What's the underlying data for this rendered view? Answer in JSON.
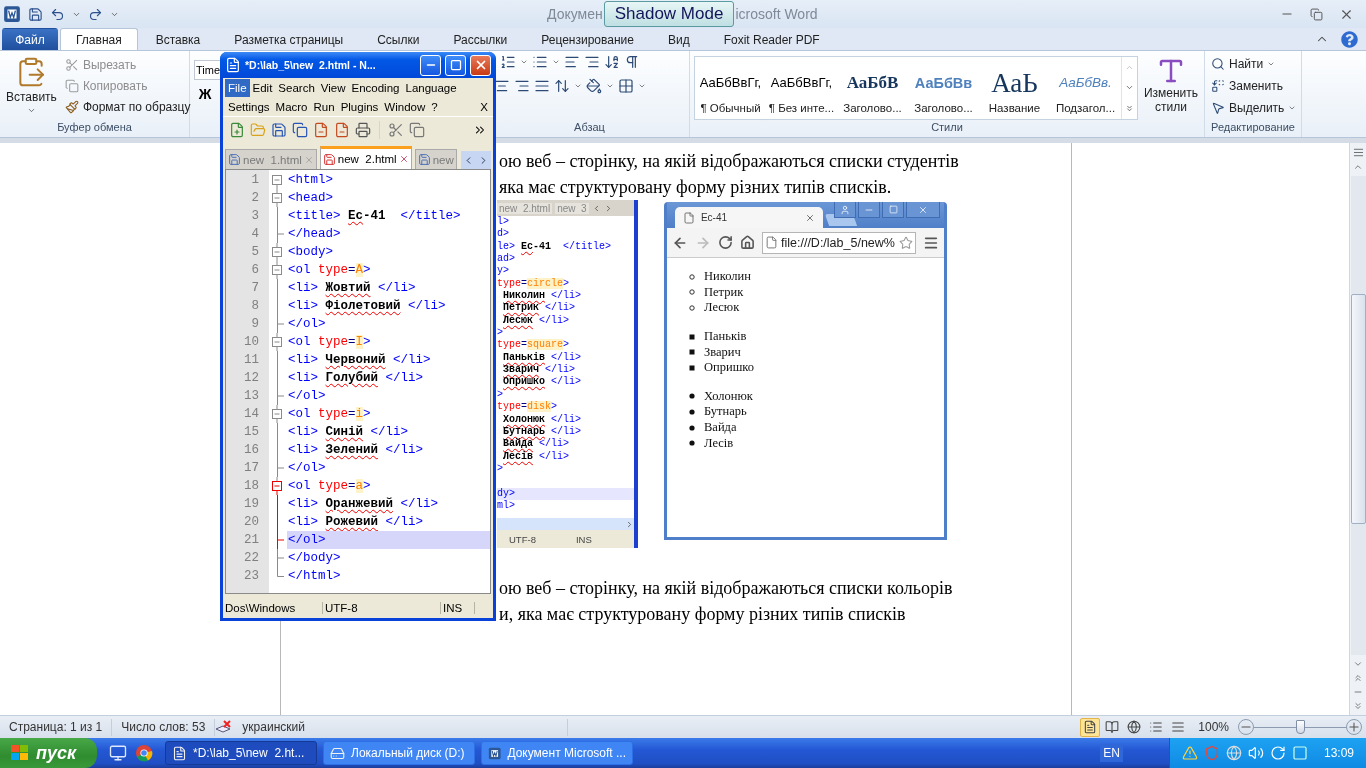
{
  "word": {
    "title": {
      "before": "Докумен",
      "overlay": "Shadow Mode",
      "after": "icrosoft Word"
    },
    "tabs": [
      {
        "label": "Файл",
        "kind": "file",
        "selected": false
      },
      {
        "label": "Главная",
        "kind": "tab",
        "selected": true
      },
      {
        "label": "Вставка",
        "kind": "tab",
        "selected": false
      },
      {
        "label": "Разметка страницы",
        "kind": "tab",
        "selected": false
      },
      {
        "label": "Ссылки",
        "kind": "tab",
        "selected": false
      },
      {
        "label": "Рассылки",
        "kind": "tab",
        "selected": false
      },
      {
        "label": "Рецензирование",
        "kind": "tab",
        "selected": false
      },
      {
        "label": "Вид",
        "kind": "tab",
        "selected": false
      },
      {
        "label": "Foxit Reader PDF",
        "kind": "tab",
        "selected": false
      }
    ],
    "clipboard": {
      "paste": "Вставить",
      "actions": [
        {
          "label": "Вырезать",
          "disabled": true
        },
        {
          "label": "Копировать",
          "disabled": true
        },
        {
          "label": "Формат по образцу",
          "disabled": false
        }
      ],
      "label": "Буфер обмена"
    },
    "font": {
      "font_name": "Time",
      "bold": "Ж"
    },
    "paragraph": {
      "label": "Абзац"
    },
    "styles": {
      "items": [
        {
          "sample": "АаБбВвГг,",
          "name": "¶ Обычный",
          "kind": "normal"
        },
        {
          "sample": "АаБбВвГг,",
          "name": "¶ Без инте...",
          "kind": "normal"
        },
        {
          "sample": "АаБбВ",
          "name": "Заголово...",
          "kind": "heading1"
        },
        {
          "sample": "АаБбВв",
          "name": "Заголово...",
          "kind": "heading2"
        },
        {
          "sample": "АаЬ",
          "name": "Название",
          "kind": "title"
        },
        {
          "sample": "АаБбВв.",
          "name": "Подзагол...",
          "kind": "subtitle"
        }
      ],
      "change": "Изменить стили",
      "label": "Стили"
    },
    "editing": {
      "actions": [
        "Найти",
        "Заменить",
        "Выделить"
      ],
      "label": "Редактирование"
    },
    "document": {
      "lines_top": [
        "ою веб – сторінку, на якій відображаються списки студентів",
        "яка має структуровану форму різних типів списків."
      ],
      "figure": {
        "editor": {
          "tabs": [
            "new  2.html",
            "new  3"
          ],
          "lines": [
            {
              "selected": false,
              "tokens": [
                {
                  "kind": "tag",
                  "text": "l>"
                }
              ]
            },
            {
              "selected": false,
              "tokens": [
                {
                  "kind": "tag",
                  "text": "d>"
                }
              ]
            },
            {
              "selected": false,
              "tokens": [
                {
                  "kind": "tag",
                  "text": "le> "
                },
                {
                  "kind": "text",
                  "text": "Ес"
                },
                {
                  "kind": "plain",
                  "text": "-41  "
                },
                {
                  "kind": "tag",
                  "text": "</title>"
                }
              ]
            },
            {
              "selected": false,
              "tokens": [
                {
                  "kind": "tag",
                  "text": "ad>"
                }
              ]
            },
            {
              "selected": false,
              "tokens": [
                {
                  "kind": "tag",
                  "text": "y>"
                }
              ]
            },
            {
              "selected": false,
              "tokens": [
                {
                  "kind": "attr",
                  "text": "type"
                },
                {
                  "kind": "eq",
                  "text": "="
                },
                {
                  "kind": "value",
                  "text": "circle"
                },
                {
                  "kind": "tag",
                  "text": ">"
                }
              ]
            },
            {
              "selected": false,
              "tokens": [
                {
                  "kind": "text",
                  "text": "Николин"
                },
                {
                  "kind": "tag",
                  "text": " </li>"
                }
              ]
            },
            {
              "selected": false,
              "tokens": [
                {
                  "kind": "text",
                  "text": "Петрик"
                },
                {
                  "kind": "tag",
                  "text": " </li>"
                }
              ]
            },
            {
              "selected": false,
              "tokens": [
                {
                  "kind": "text",
                  "text": "Лесюк"
                },
                {
                  "kind": "tag",
                  "text": " </li>"
                }
              ]
            },
            {
              "selected": false,
              "tokens": [
                {
                  "kind": "tag",
                  "text": ">"
                }
              ]
            },
            {
              "selected": false,
              "tokens": [
                {
                  "kind": "attr",
                  "text": "type"
                },
                {
                  "kind": "eq",
                  "text": "="
                },
                {
                  "kind": "value",
                  "text": "square"
                },
                {
                  "kind": "tag",
                  "text": ">"
                }
              ]
            },
            {
              "selected": false,
              "tokens": [
                {
                  "kind": "text",
                  "text": "Паньків"
                },
                {
                  "kind": "tag",
                  "text": " </li>"
                }
              ]
            },
            {
              "selected": false,
              "tokens": [
                {
                  "kind": "text",
                  "text": "Зварич"
                },
                {
                  "kind": "tag",
                  "text": " </li>"
                }
              ]
            },
            {
              "selected": false,
              "tokens": [
                {
                  "kind": "text",
                  "text": "Опришко"
                },
                {
                  "kind": "tag",
                  "text": " </li>"
                }
              ]
            },
            {
              "selected": false,
              "tokens": [
                {
                  "kind": "tag",
                  "text": ">"
                }
              ]
            },
            {
              "selected": false,
              "tokens": [
                {
                  "kind": "attr",
                  "text": "type"
                },
                {
                  "kind": "eq",
                  "text": "="
                },
                {
                  "kind": "value",
                  "text": "disk"
                },
                {
                  "kind": "tag",
                  "text": ">"
                }
              ]
            },
            {
              "selected": false,
              "tokens": [
                {
                  "kind": "text",
                  "text": "Холонюк"
                },
                {
                  "kind": "tag",
                  "text": " </li>"
                }
              ]
            },
            {
              "selected": false,
              "tokens": [
                {
                  "kind": "text",
                  "text": "Бутнарь"
                },
                {
                  "kind": "tag",
                  "text": " </li>"
                }
              ]
            },
            {
              "selected": false,
              "tokens": [
                {
                  "kind": "text",
                  "text": "Вайда"
                },
                {
                  "kind": "tag",
                  "text": " </li>"
                }
              ]
            },
            {
              "selected": false,
              "tokens": [
                {
                  "kind": "text",
                  "text": "Лесів"
                },
                {
                  "kind": "tag",
                  "text": " </li>"
                }
              ]
            },
            {
              "selected": false,
              "tokens": [
                {
                  "kind": "tag",
                  "text": ">"
                }
              ]
            },
            {
              "selected": false
            },
            {
              "selected": true,
              "tokens": [
                {
                  "kind": "tag",
                  "text": "dy>"
                }
              ]
            },
            {
              "selected": false,
              "tokens": [
                {
                  "kind": "tag",
                  "text": "ml>"
                }
              ]
            }
          ],
          "status": [
            "UTF-8",
            "INS"
          ]
        },
        "browser": {
          "tab_title": "Ес-41",
          "address": "file:///D:/lab_5/new%",
          "lists": [
            {
              "kind": "circle",
              "items": [
                "Николин",
                "Петрик",
                "Лесюк"
              ]
            },
            {
              "kind": "square",
              "items": [
                "Паньків",
                "Зварич",
                "Опришко"
              ]
            },
            {
              "kind": "disc",
              "items": [
                "Холонюк",
                "Бутнарь",
                "Вайда",
                "Лесів"
              ]
            }
          ]
        }
      },
      "lines_bottom": [
        "ою веб – сторінку, на якій відображаються списки кольорів",
        "и, яка має структуровану форму різних типів списків"
      ]
    },
    "status_bar": {
      "page": "Страница: 1 из 1",
      "words": "Число слов: 53",
      "language": "украинский",
      "view_buttons": [
        {
          "kind": "print",
          "selected": true
        },
        {
          "kind": "reading",
          "selected": false
        },
        {
          "kind": "web",
          "selected": false
        },
        {
          "kind": "outline",
          "selected": false
        },
        {
          "kind": "draft",
          "selected": false
        }
      ],
      "zoom": "100%",
      "level": 0.5
    }
  },
  "notepad": {
    "title": "*D:\\lab_5\\new  2.html - N...",
    "menu_rows": [
      [
        {
          "label": "File",
          "selected": true
        },
        {
          "label": "Edit",
          "selected": false
        },
        {
          "label": "Search",
          "selected": false
        },
        {
          "label": "View",
          "selected": false
        },
        {
          "label": "Encoding",
          "selected": false
        },
        {
          "label": "Language",
          "selected": false
        }
      ],
      [
        {
          "label": "Settings",
          "selected": false
        },
        {
          "label": "Macro",
          "selected": false
        },
        {
          "label": "Run",
          "selected": false
        },
        {
          "label": "Plugins",
          "selected": false
        },
        {
          "label": "Window",
          "selected": false
        },
        {
          "label": "?",
          "selected": false
        },
        {
          "label": "X",
          "selected": false
        }
      ]
    ],
    "tabs": [
      {
        "label": "new  1.html",
        "selected": false,
        "modified": false
      },
      {
        "label": "new  2.html",
        "selected": true,
        "modified": true
      },
      {
        "label": "new",
        "selected": false,
        "modified": false
      }
    ],
    "lines": [
      {
        "n": "1",
        "kind": "open",
        "fold_active": false,
        "selected": false,
        "tokens": [
          {
            "kind": "tag",
            "text": "<html>"
          }
        ]
      },
      {
        "n": "2",
        "kind": "open",
        "fold_active": false,
        "selected": false,
        "tokens": [
          {
            "kind": "tag",
            "text": "<head>"
          }
        ]
      },
      {
        "n": "3",
        "kind": "mid",
        "fold_active": false,
        "selected": false,
        "tokens": [
          {
            "kind": "tag",
            "text": "<title> "
          },
          {
            "kind": "text",
            "text": "Ес"
          },
          {
            "kind": "plain",
            "text": "-41  "
          },
          {
            "kind": "tag",
            "text": "</title>"
          }
        ]
      },
      {
        "n": "4",
        "kind": "end",
        "fold_active": false,
        "selected": false,
        "tokens": [
          {
            "kind": "tag",
            "text": "</head>"
          }
        ]
      },
      {
        "n": "5",
        "kind": "open",
        "fold_active": false,
        "selected": false,
        "tokens": [
          {
            "kind": "tag",
            "text": "<body>"
          }
        ]
      },
      {
        "n": "6",
        "kind": "open",
        "fold_active": false,
        "selected": false,
        "tokens": [
          {
            "kind": "tag",
            "text": "<ol "
          },
          {
            "kind": "attr",
            "text": "type"
          },
          {
            "kind": "eq",
            "text": "="
          },
          {
            "kind": "value",
            "text": "A"
          },
          {
            "kind": "tag",
            "text": ">"
          }
        ]
      },
      {
        "n": "7",
        "kind": "mid",
        "fold_active": false,
        "selected": false,
        "tokens": [
          {
            "kind": "tag",
            "text": "<li> "
          },
          {
            "kind": "text",
            "text": "Жовтий"
          },
          {
            "kind": "tag",
            "text": " </li>"
          }
        ]
      },
      {
        "n": "8",
        "kind": "mid",
        "fold_active": false,
        "selected": false,
        "tokens": [
          {
            "kind": "tag",
            "text": "<li> "
          },
          {
            "kind": "text",
            "text": "Фіолетовий"
          },
          {
            "kind": "tag",
            "text": " </li>"
          }
        ]
      },
      {
        "n": "9",
        "kind": "end",
        "fold_active": false,
        "selected": false,
        "tokens": [
          {
            "kind": "tag",
            "text": "</ol>"
          }
        ]
      },
      {
        "n": "10",
        "kind": "open",
        "fold_active": false,
        "selected": false,
        "tokens": [
          {
            "kind": "tag",
            "text": "<ol "
          },
          {
            "kind": "attr",
            "text": "type"
          },
          {
            "kind": "eq",
            "text": "="
          },
          {
            "kind": "value",
            "text": "I"
          },
          {
            "kind": "tag",
            "text": ">"
          }
        ]
      },
      {
        "n": "11",
        "kind": "mid",
        "fold_active": false,
        "selected": false,
        "tokens": [
          {
            "kind": "tag",
            "text": "<li> "
          },
          {
            "kind": "text",
            "text": "Червоний"
          },
          {
            "kind": "tag",
            "text": " </li>"
          }
        ]
      },
      {
        "n": "12",
        "kind": "mid",
        "fold_active": false,
        "selected": false,
        "tokens": [
          {
            "kind": "tag",
            "text": "<li> "
          },
          {
            "kind": "text",
            "text": "Голубий"
          },
          {
            "kind": "tag",
            "text": " </li>"
          }
        ]
      },
      {
        "n": "13",
        "kind": "end",
        "fold_active": false,
        "selected": false,
        "tokens": [
          {
            "kind": "tag",
            "text": "</ol>"
          }
        ]
      },
      {
        "n": "14",
        "kind": "open",
        "fold_active": false,
        "selected": false,
        "tokens": [
          {
            "kind": "tag",
            "text": "<ol "
          },
          {
            "kind": "attr",
            "text": "type"
          },
          {
            "kind": "eq",
            "text": "="
          },
          {
            "kind": "value",
            "text": "i"
          },
          {
            "kind": "tag",
            "text": ">"
          }
        ]
      },
      {
        "n": "15",
        "kind": "mid",
        "fold_active": false,
        "selected": false,
        "tokens": [
          {
            "kind": "tag",
            "text": "<li> "
          },
          {
            "kind": "text",
            "text": "Синій"
          },
          {
            "kind": "tag",
            "text": " </li>"
          }
        ]
      },
      {
        "n": "16",
        "kind": "mid",
        "fold_active": false,
        "selected": false,
        "tokens": [
          {
            "kind": "tag",
            "text": "<li> "
          },
          {
            "kind": "text",
            "text": "Зелений"
          },
          {
            "kind": "tag",
            "text": " </li>"
          }
        ]
      },
      {
        "n": "17",
        "kind": "end",
        "fold_active": false,
        "selected": false,
        "tokens": [
          {
            "kind": "tag",
            "text": "</ol>"
          }
        ]
      },
      {
        "n": "18",
        "kind": "open",
        "fold_active": true,
        "selected": false,
        "tokens": [
          {
            "kind": "tag",
            "text": "<ol "
          },
          {
            "kind": "attr",
            "text": "type"
          },
          {
            "kind": "eq",
            "text": "="
          },
          {
            "kind": "value",
            "text": "a"
          },
          {
            "kind": "tag",
            "text": ">"
          }
        ]
      },
      {
        "n": "19",
        "kind": "mid",
        "fold_active": true,
        "selected": false,
        "tokens": [
          {
            "kind": "tag",
            "text": "<li> "
          },
          {
            "kind": "text",
            "text": "Оранжевий"
          },
          {
            "kind": "tag",
            "text": " </li>"
          }
        ]
      },
      {
        "n": "20",
        "kind": "mid",
        "fold_active": true,
        "selected": false,
        "tokens": [
          {
            "kind": "tag",
            "text": "<li> "
          },
          {
            "kind": "text",
            "text": "Рожевий"
          },
          {
            "kind": "tag",
            "text": " </li>"
          }
        ]
      },
      {
        "n": "21",
        "kind": "end",
        "fold_active": true,
        "selected": true,
        "tokens": [
          {
            "kind": "tag",
            "text": "</ol>"
          }
        ]
      },
      {
        "n": "22",
        "kind": "end",
        "fold_active": false,
        "selected": false,
        "tokens": [
          {
            "kind": "tag",
            "text": "</body>"
          }
        ]
      },
      {
        "n": "23",
        "kind": "last",
        "fold_active": false,
        "selected": false,
        "tokens": [
          {
            "kind": "tag",
            "text": "</html>"
          }
        ]
      }
    ],
    "status": [
      "Dos\\Windows",
      "UTF-8",
      "INS"
    ]
  },
  "taskbar": {
    "start": "пуск",
    "tasks": [
      {
        "label": "*D:\\lab_5\\new  2.ht...",
        "kind": "notepad",
        "selected": true
      },
      {
        "label": "Локальный диск (D:)",
        "kind": "drive",
        "selected": false
      },
      {
        "label": "Документ Microsoft ...",
        "kind": "word",
        "selected": false
      }
    ],
    "language": "EN",
    "clock": "13:09"
  }
}
